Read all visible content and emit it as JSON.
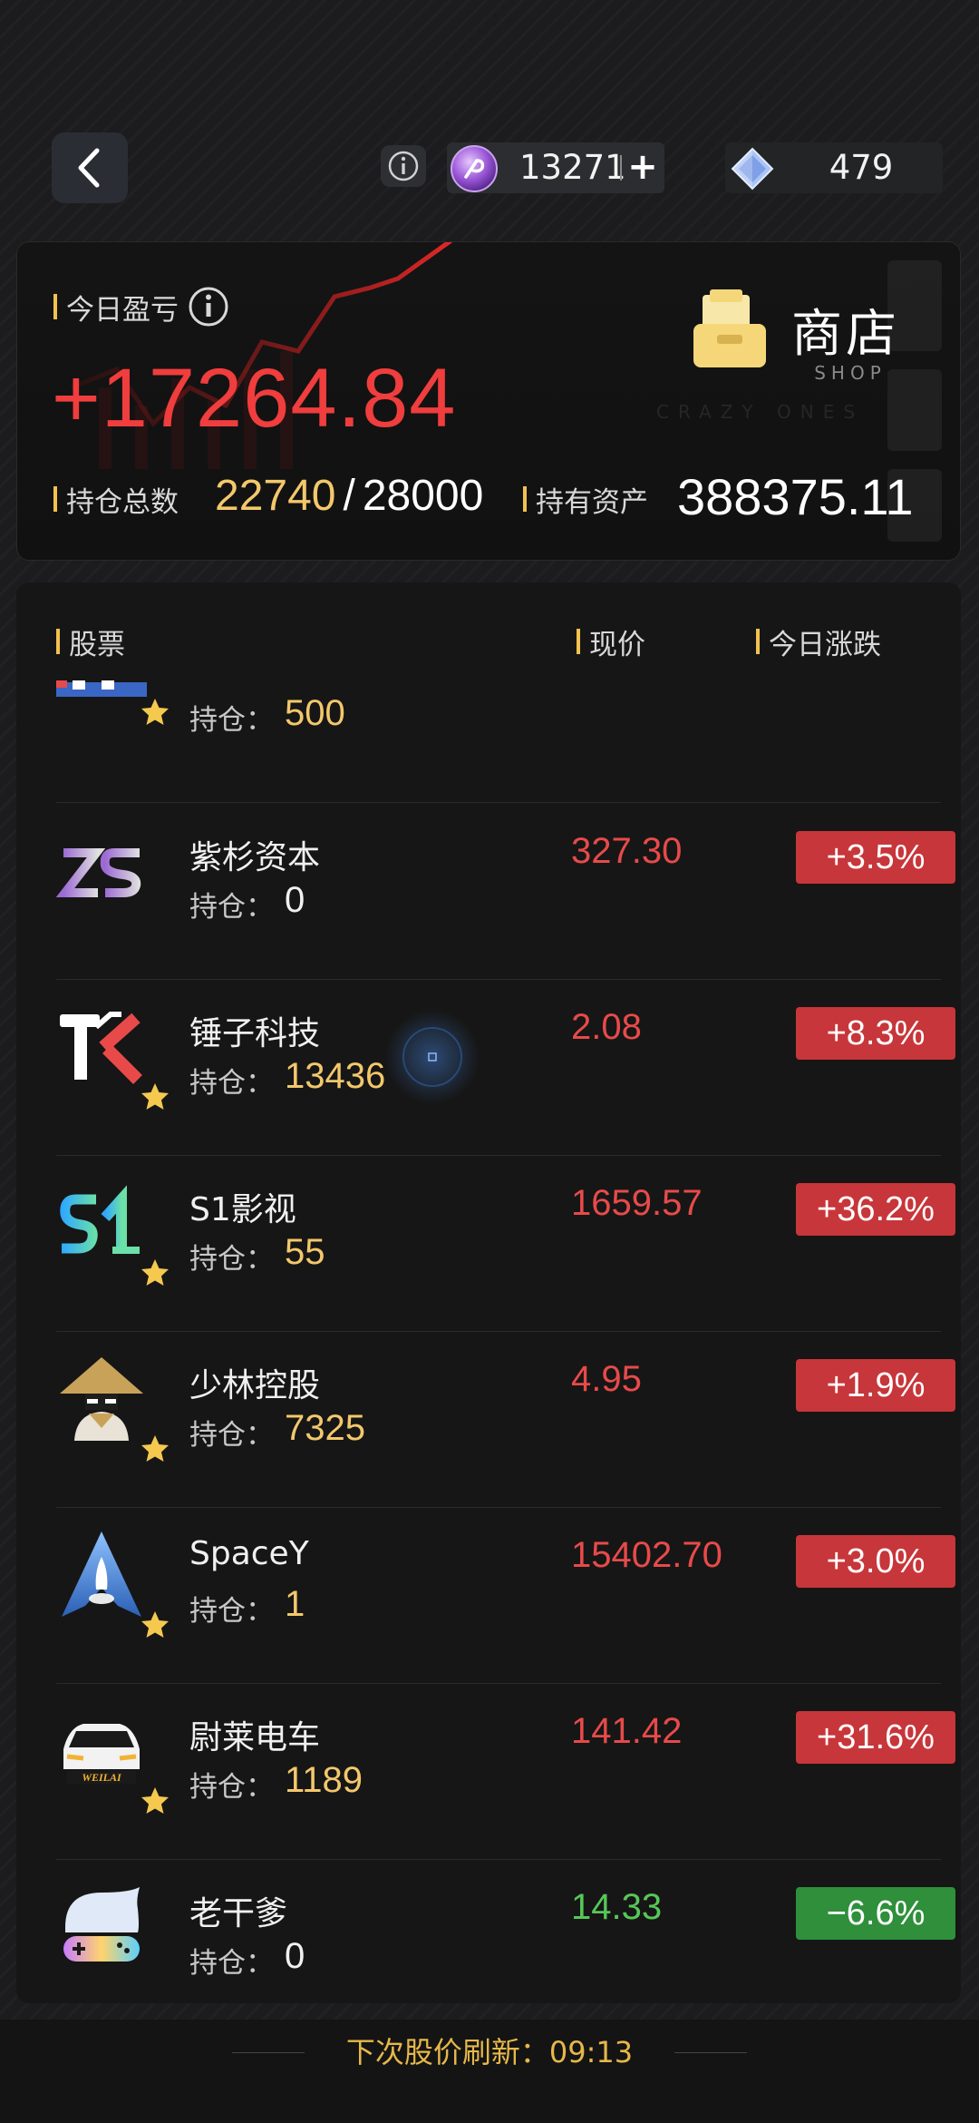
{
  "topbar": {
    "coins": "13271",
    "coins_add": "+",
    "gems": "479"
  },
  "summary": {
    "today_pnl_label": "今日盈亏",
    "today_pnl_value": "+17264.84",
    "holdings_label": "持仓总数",
    "holdings_current": "22740",
    "holdings_sep": "/",
    "holdings_max": "28000",
    "assets_label": "持有资产",
    "assets_value": "388375.11",
    "shop_label": "商店",
    "shop_sub": "SHOP",
    "watermark": "CRAZY ONES"
  },
  "list": {
    "headers": {
      "stock": "股票",
      "price": "现价",
      "change": "今日涨跌"
    },
    "hold_prefix": "持仓：",
    "partial_row": {
      "holding": "500"
    },
    "stocks": [
      {
        "name": "紫杉资本",
        "holding": "0",
        "price": "327.30",
        "change": "+3.5%",
        "starred": false
      },
      {
        "name": "锤子科技",
        "holding": "13436",
        "price": "2.08",
        "change": "+8.3%",
        "starred": true
      },
      {
        "name": "S1影视",
        "holding": "55",
        "price": "1659.57",
        "change": "+36.2%",
        "starred": true
      },
      {
        "name": "少林控股",
        "holding": "7325",
        "price": "4.95",
        "change": "+1.9%",
        "starred": true
      },
      {
        "name": "SpaceY",
        "holding": "1",
        "price": "15402.70",
        "change": "+3.0%",
        "starred": true
      },
      {
        "name": "尉莱电车",
        "holding": "1189",
        "price": "141.42",
        "change": "+31.6%",
        "starred": true
      },
      {
        "name": "老干爹",
        "holding": "0",
        "price": "14.33",
        "change": "−6.6%",
        "starred": false
      }
    ],
    "logo_text": {
      "weilai": "WEILAI"
    }
  },
  "footer": {
    "refresh_text": "下次股价刷新：09:13"
  },
  "colors": {
    "up": "#e84a4a",
    "down": "#57c758",
    "accent": "#f3c86b"
  }
}
